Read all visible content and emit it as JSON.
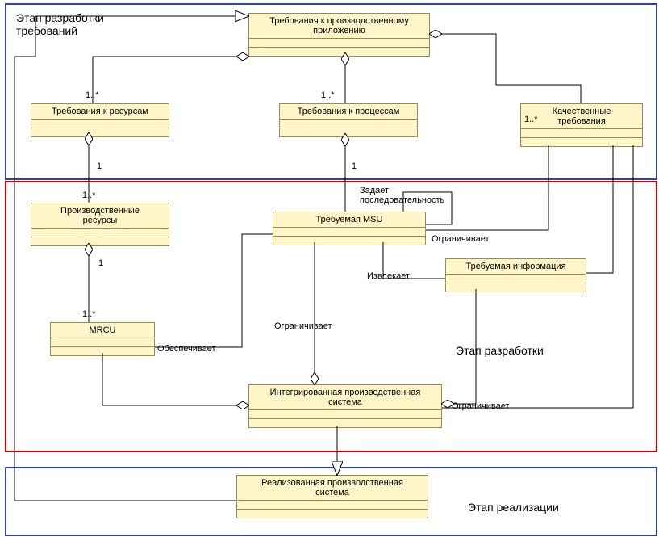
{
  "stages": {
    "requirements": "Этап разработки\nтребований",
    "development": "Этап разработки",
    "realization": "Этап реализации"
  },
  "classes": {
    "req_app": "Требования к производственному\nприложению",
    "req_res": "Требования к ресурсам",
    "req_proc": "Требования к процессам",
    "qual_req": "Качественные\nтребования",
    "prod_res": "Производственные\nресурсы",
    "req_msu": "Требуемая MSU",
    "req_info": "Требуемая информация",
    "mrcu": "MRCU",
    "ips": "Интегрированная производственная\nсистема",
    "real_sys": "Реализованная производственная\nсистема"
  },
  "mult": {
    "m1s": "1..*",
    "m1": "1"
  },
  "edge_labels": {
    "seq": "Задает\nпоследовательность",
    "constrains": "Ограничивает",
    "extracts": "Извлекает",
    "provides": "Обеспечивает"
  },
  "chart_data": {
    "type": "uml-class-diagram",
    "packages": [
      {
        "id": "stage_req",
        "label": "Этап разработки требований",
        "contains": [
          "req_app",
          "req_res",
          "req_proc",
          "qual_req"
        ]
      },
      {
        "id": "stage_dev",
        "label": "Этап разработки",
        "contains": [
          "prod_res",
          "req_msu",
          "req_info",
          "mrcu",
          "ips"
        ]
      },
      {
        "id": "stage_real",
        "label": "Этап реализации",
        "contains": [
          "real_sys"
        ]
      }
    ],
    "classes": [
      {
        "id": "req_app",
        "name": "Требования к производственному приложению"
      },
      {
        "id": "req_res",
        "name": "Требования к ресурсам"
      },
      {
        "id": "req_proc",
        "name": "Требования к процессам"
      },
      {
        "id": "qual_req",
        "name": "Качественные требования"
      },
      {
        "id": "prod_res",
        "name": "Производственные ресурсы"
      },
      {
        "id": "req_msu",
        "name": "Требуемая MSU"
      },
      {
        "id": "req_info",
        "name": "Требуемая информация"
      },
      {
        "id": "mrcu",
        "name": "MRCU"
      },
      {
        "id": "ips",
        "name": "Интегрированная производственная система"
      },
      {
        "id": "real_sys",
        "name": "Реализованная производственная система"
      }
    ],
    "relations": [
      {
        "type": "aggregation",
        "whole": "req_app",
        "part": "req_res",
        "mult_whole": "",
        "mult_part": "1..*"
      },
      {
        "type": "aggregation",
        "whole": "req_app",
        "part": "req_proc",
        "mult_whole": "",
        "mult_part": "1..*"
      },
      {
        "type": "aggregation",
        "whole": "req_app",
        "part": "qual_req",
        "mult_whole": "",
        "mult_part": "1..*"
      },
      {
        "type": "aggregation",
        "whole": "req_res",
        "part": "prod_res",
        "mult_whole": "1",
        "mult_part": "1..*"
      },
      {
        "type": "aggregation",
        "whole": "req_proc",
        "part": "req_msu",
        "mult_whole": "1",
        "mult_part": ""
      },
      {
        "type": "aggregation",
        "whole": "prod_res",
        "part": "mrcu",
        "mult_whole": "1",
        "mult_part": "1..*"
      },
      {
        "type": "aggregation",
        "whole": "ips",
        "part": "mrcu"
      },
      {
        "type": "aggregation",
        "whole": "ips",
        "part": "req_msu"
      },
      {
        "type": "aggregation",
        "whole": "ips",
        "part": "req_info"
      },
      {
        "type": "association",
        "from": "req_msu",
        "to": "req_msu",
        "label": "Задает последовательность",
        "self": true
      },
      {
        "type": "association",
        "from": "mrcu",
        "to": "req_msu",
        "label": "Обеспечивает"
      },
      {
        "type": "association",
        "from": "req_info",
        "to": "req_msu",
        "label": "Извлекает"
      },
      {
        "type": "association",
        "from": "qual_req",
        "to": "req_msu",
        "label": "Ограничивает"
      },
      {
        "type": "association",
        "from": "qual_req",
        "to": "req_info",
        "label": "Ограничивает"
      },
      {
        "type": "association",
        "from": "qual_req",
        "to": "ips",
        "label": "Ограничивает"
      },
      {
        "type": "generalization",
        "child": "real_sys",
        "parent": "req_app"
      },
      {
        "type": "generalization",
        "child": "ips",
        "parent": "real_sys"
      }
    ]
  }
}
